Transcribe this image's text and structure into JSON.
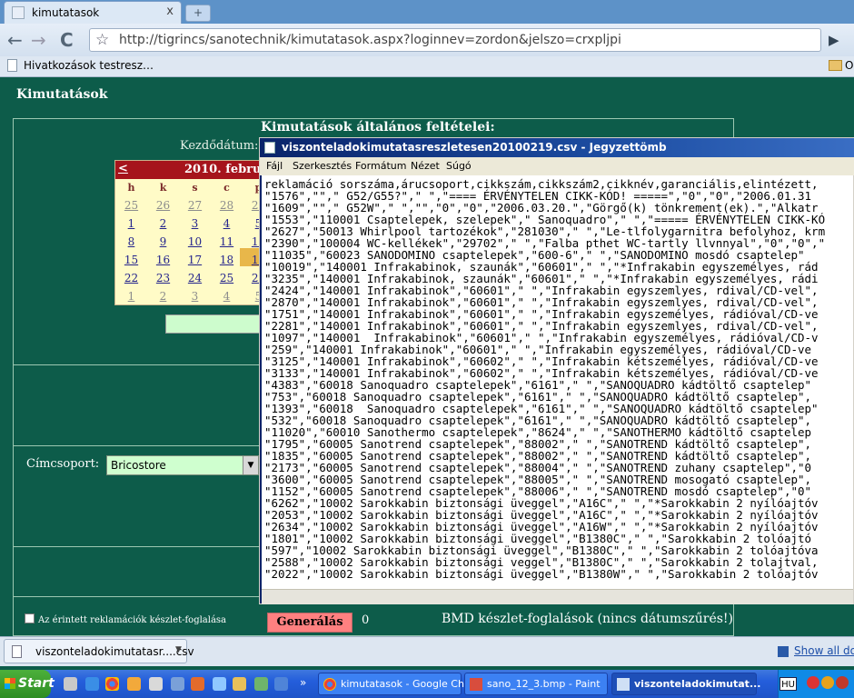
{
  "browser": {
    "tab_title": "kimutatasok",
    "tab_close": "x",
    "new_tab": "+",
    "back": "←",
    "forward": "→",
    "reload": "C",
    "url": "http://tigrincs/sanotechnik/kimutatasok.aspx?loginnev=zordon&jelszo=crxpljpi",
    "bookmark_label": "Hivatkozások testresz…",
    "bookmark_right": "O"
  },
  "page": {
    "title": "Kimutatások",
    "section_title": "Kimutatások általános feltételei:",
    "start_date_label": "Kezdődátum:",
    "customer_group_label": "Címcsoport:",
    "customer_group_value": "Bricostore",
    "checkbox_label": "Az érintett reklamációk készlet-foglalása",
    "generate_button": "Generálás",
    "count": "0",
    "bmd_label": "BMD készlet-foglalások (nincs dátumszűrés!)"
  },
  "calendar": {
    "prev": "<",
    "month_title": "2010. február",
    "day_headers": [
      "h",
      "k",
      "s",
      "c",
      "p"
    ],
    "weeks": [
      [
        "25",
        "26",
        "27",
        "28",
        "29"
      ],
      [
        "1",
        "2",
        "3",
        "4",
        "5"
      ],
      [
        "8",
        "9",
        "10",
        "11",
        "12"
      ],
      [
        "15",
        "16",
        "17",
        "18",
        "19"
      ],
      [
        "22",
        "23",
        "24",
        "25",
        "26"
      ],
      [
        "1",
        "2",
        "3",
        "4",
        "5"
      ]
    ]
  },
  "notepad": {
    "title": "viszonteladokimutatasreszletesen20100219.csv - Jegyzettömb",
    "menu": [
      "Fájl",
      "Szerkesztés",
      "Formátum",
      "Nézet",
      "Súgó"
    ],
    "content": "reklamáció sorszáma,árucsoport,cikkszám,cikkszám2,cikknév,garanciális,elintézett,\n\"1576\",\"\",\" G52/G55?\",\" \",\"==== ÉRVÉNYTELEN CIKK-KÓD! =====\",\"0\",\"0\",\"2006.01.31\n\"1609\",\"\",\" G52W\",\" \",\"\",\"0\",\"0\",\"2006.03.20.\",\"Görgő(k) tönkrement(ek).\",\"Alkatr\n\"1553\",\"110001 Csaptelepek, szelepek\",\" Sanoquadro\",\" \",\"===== ÉRVÉNYTELEN CIKK-KÓ\n\"2627\",\"50013 Whirlpool tartozékok\",\"281030\",\" \",\"Le-tlfolygarnitra befolyhoz, krm\n\"2390\",\"100004 WC-kellékek\",\"29702\",\" \",\"Falba pthet WC-tartly llvnnyal\",\"0\",\"0\",\"\n\"11035\",\"60023 SANODOMINO csaptelepek\",\"600-6\",\" \",\"SANODOMINO mosdó csaptelep\"\n\"10019\",\"140001 Infrakabinok, szaunák\",\"60601\",\" \",\"*Infrakabin egyszemélyes, rád\n\"3235\",\"140001 Infrakabinok, szaunák\",\"60601\",\" \",\"*Infrakabin egyszemélyes, rádi\n\"2424\",\"140001 Infrakabinok\",\"60601\",\" \",\"Infrakabin egyszemlyes, rdival/CD-vel\",\n\"2870\",\"140001 Infrakabinok\",\"60601\",\" \",\"Infrakabin egyszemlyes, rdival/CD-vel\",\n\"1751\",\"140001 Infrakabinok\",\"60601\",\" \",\"Infrakabin egyszemélyes, rádióval/CD-ve\n\"2281\",\"140001 Infrakabinok\",\"60601\",\" \",\"Infrakabin egyszemlyes, rdival/CD-vel\",\n\"1097\",\"140001  Infrakabinok\",\"60601\",\" \",\"Infrakabin egyszemélyes, rádióval/CD-v\n\"259\",\"140001 Infrakabinok\",\"60601\",\" \",\"Infrakabin egyszemélyes, rádióval/CD-ve\n\"3125\",\"140001 Infrakabinok\",\"60602\",\" \",\"Infrakabin kétszemélyes, rádióval/CD-ve\n\"3133\",\"140001 Infrakabinok\",\"60602\",\" \",\"Infrakabin kétszemélyes, rádióval/CD-ve\n\"4383\",\"60018 Sanoquadro csaptelepek\",\"6161\",\" \",\"SANOQUADRO kádtöltő csaptelep\"\n\"753\",\"60018 Sanoquadro csaptelepek\",\"6161\",\" \",\"SANOQUADRO kádtöltő csaptelep\",\n\"1393\",\"60018  Sanoquadro csaptelepek\",\"6161\",\" \",\"SANOQUADRO kádtöltő csaptelep\"\n\"532\",\"60018 Sanoquadro csaptelepek\",\"6161\",\" \",\"SANOQUADRO kádtöltő csaptelep\",\n\"11020\",\"60010 Sanothermo csaptelepek\",\"8624\",\" \",\"SANOTHERMO kádtöltő csaptelep\n\"1795\",\"60005 Sanotrend csaptelepek\",\"88002\",\" \",\"SANOTREND kádtöltő csaptelep\",\n\"1835\",\"60005 Sanotrend csaptelepek\",\"88002\",\" \",\"SANOTREND kádtöltő csaptelep\",\n\"2173\",\"60005 Sanotrend csaptelepek\",\"88004\",\" \",\"SANOTREND zuhany csaptelep\",\"0\n\"3600\",\"60005 Sanotrend csaptelepek\",\"88005\",\" \",\"SANOTREND mosogató csaptelep\",\n\"1152\",\"60005 Sanotrend csaptelepek\",\"88006\",\" \",\"SANOTREND mosdó csaptelep\",\"0\"\n\"6262\",\"10002 Sarokkabin biztonsági üveggel\",\"A16C\",\" \",\"*Sarokkabin 2 nyílóajtóv\n\"2053\",\"10002 Sarokkabin biztonsági üveggel\",\"A16C\",\" \",\"*Sarokkabin 2 nyílóajtóv\n\"2634\",\"10002 Sarokkabin biztonsági üveggel\",\"A16W\",\" \",\"*Sarokkabin 2 nyílóajtóv\n\"1801\",\"10002 Sarokkabin biztonsági üveggel\",\"B1380C\",\" \",\"Sarokkabin 2 tolóajtó\n\"597\",\"10002 Sarokkabin biztonsági üveggel\",\"B1380C\",\" \",\"Sarokkabin 2 tolóajtóva\n\"2588\",\"10002 Sarokkabin biztonsági veggel\",\"B1380C\",\" \",\"Sarokkabin 2 tolajtval,\n\"2022\",\"10002 Sarokkabin biztonsági üveggel\",\"B1380W\",\" \",\"Sarokkabin 2 tolóajtóv"
  },
  "downloads": {
    "file_name": "viszonteladokimutatasr....csv",
    "show_all": "Show all down"
  },
  "taskbar": {
    "start": "Start",
    "more": "»",
    "tasks": [
      {
        "label": "kimutatasok - Google Chr...",
        "active": false
      },
      {
        "label": "sano_12_3.bmp - Paint",
        "active": false
      },
      {
        "label": "viszonteladokimutat...",
        "active": true
      }
    ],
    "language": "HU"
  },
  "colors": {
    "page_bg": "#0d5c4a",
    "calendar_header": "#a6141c",
    "calendar_bg": "#fffbc7",
    "generate_button": "#ff8080",
    "input_bg": "#cdfccd",
    "titlebar": "#0a246a"
  }
}
